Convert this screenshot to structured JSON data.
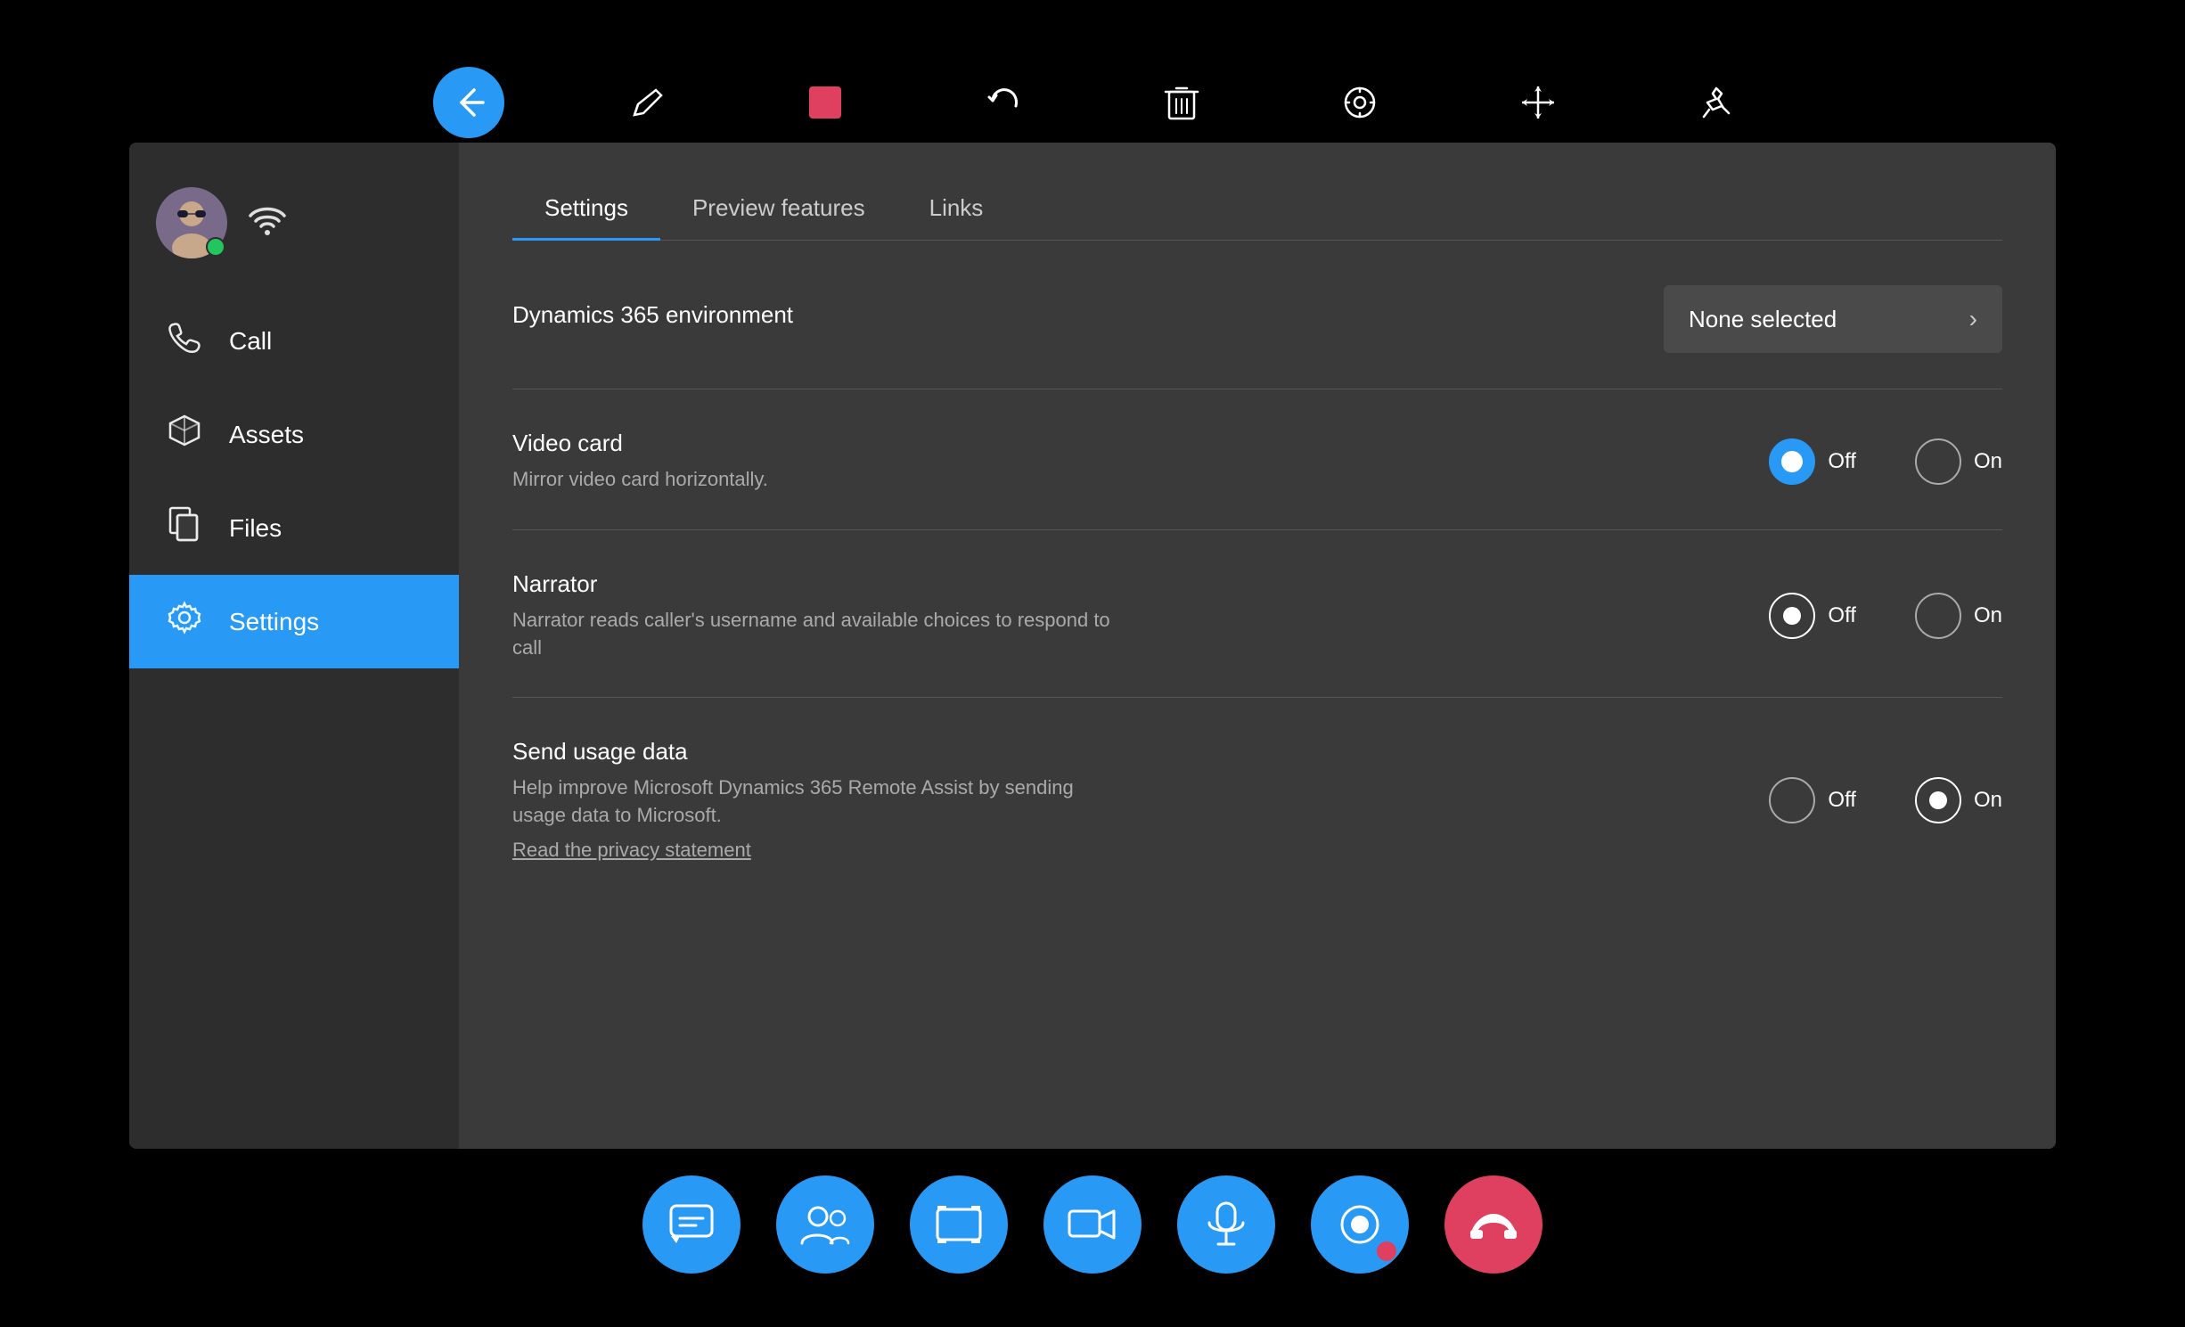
{
  "toolbar": {
    "buttons": [
      {
        "name": "back-button",
        "icon": "↩",
        "active": true
      },
      {
        "name": "pen-button",
        "icon": "✒",
        "active": false
      },
      {
        "name": "stop-button",
        "icon": "■",
        "active": false,
        "color": "red"
      },
      {
        "name": "undo-button",
        "icon": "↺",
        "active": false
      },
      {
        "name": "trash-button",
        "icon": "🗑",
        "active": false
      },
      {
        "name": "target-button",
        "icon": "◎",
        "active": false
      },
      {
        "name": "move-button",
        "icon": "✛",
        "active": false
      },
      {
        "name": "pin-button",
        "icon": "⊣",
        "active": false
      }
    ]
  },
  "sidebar": {
    "profile": {
      "status": "online"
    },
    "nav_items": [
      {
        "id": "call",
        "label": "Call",
        "icon": "📞",
        "active": false
      },
      {
        "id": "assets",
        "label": "Assets",
        "icon": "📦",
        "active": false
      },
      {
        "id": "files",
        "label": "Files",
        "icon": "📄",
        "active": false
      },
      {
        "id": "settings",
        "label": "Settings",
        "icon": "⚙",
        "active": true
      }
    ]
  },
  "content": {
    "tabs": [
      {
        "id": "settings",
        "label": "Settings",
        "active": true
      },
      {
        "id": "preview",
        "label": "Preview features",
        "active": false
      },
      {
        "id": "links",
        "label": "Links",
        "active": false
      }
    ],
    "settings": {
      "environment": {
        "label": "Dynamics 365 environment",
        "value": "None selected"
      },
      "video_card": {
        "label": "Video card",
        "description": "Mirror video card horizontally.",
        "options": [
          "Off",
          "On"
        ],
        "selected": "Off"
      },
      "narrator": {
        "label": "Narrator",
        "description": "Narrator reads caller's username and available choices to respond to call",
        "options": [
          "Off",
          "On"
        ],
        "selected": "Off"
      },
      "send_usage": {
        "label": "Send usage data",
        "description": "Help improve Microsoft Dynamics 365 Remote Assist by sending usage data to Microsoft.",
        "privacy_link": "Read the privacy statement",
        "options": [
          "Off",
          "On"
        ],
        "selected": "On"
      }
    }
  },
  "bottom_toolbar": {
    "buttons": [
      {
        "name": "chat-button",
        "icon": "💬"
      },
      {
        "name": "participants-button",
        "icon": "👥"
      },
      {
        "name": "screenshot-button",
        "icon": "⊡"
      },
      {
        "name": "video-button",
        "icon": "🎥"
      },
      {
        "name": "mic-button",
        "icon": "🎤"
      },
      {
        "name": "record-button",
        "icon": "⏺",
        "has_dot": true
      },
      {
        "name": "end-call-button",
        "icon": "📵",
        "red": true
      }
    ]
  }
}
